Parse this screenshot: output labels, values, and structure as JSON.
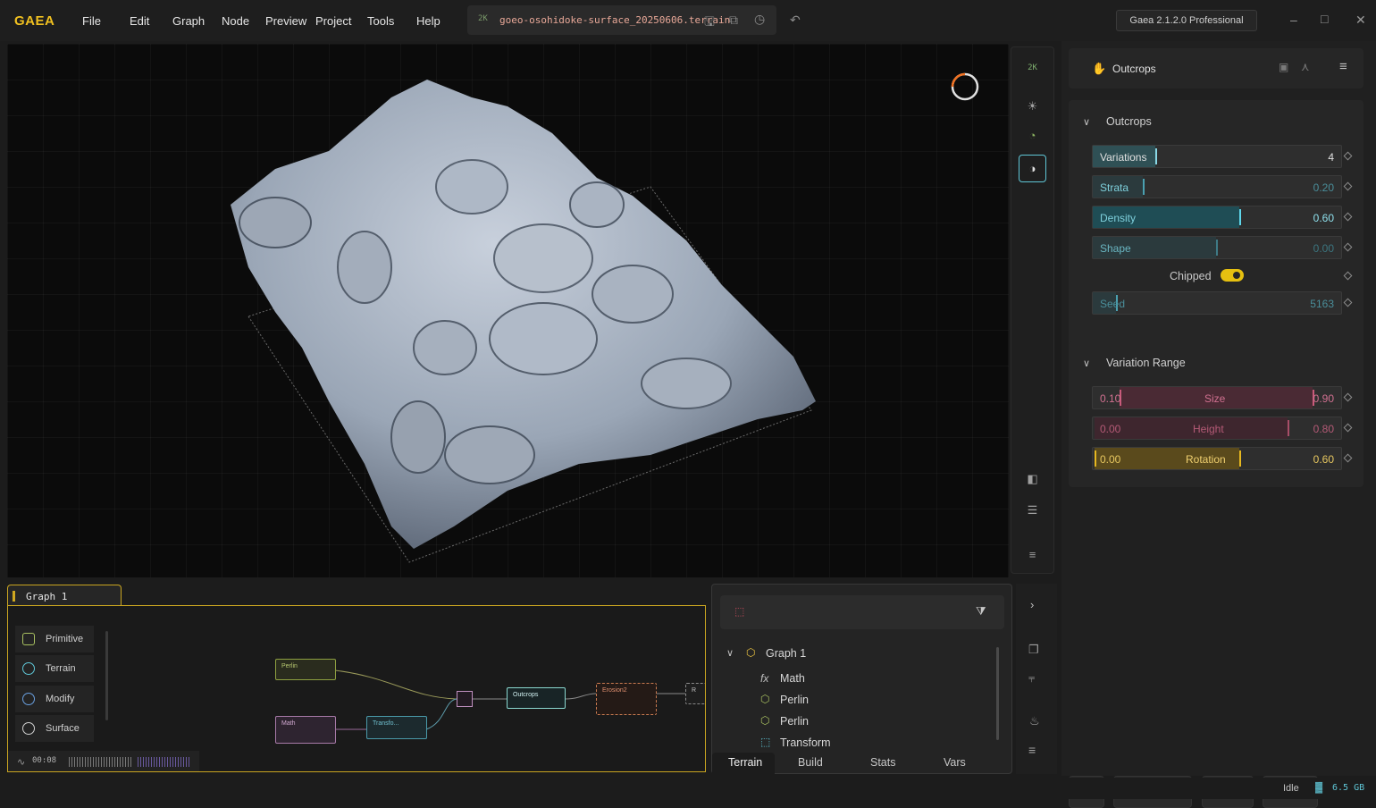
{
  "app": {
    "logo": "GAEA",
    "version": "Gaea 2.1.2.0 Professional"
  },
  "menu": [
    "File",
    "Edit",
    "Graph",
    "Node",
    "Preview",
    "Project",
    "Tools",
    "Help"
  ],
  "file": {
    "resolution_badge": "2K",
    "name": "goeo-osohidoke-surface_20250606.terrain"
  },
  "viewport_tools": {
    "resolution": "2K"
  },
  "properties": {
    "node_name": "Outcrops",
    "section1": {
      "title": "Outcrops",
      "params": [
        {
          "label": "Variations",
          "value": "4",
          "fill": 0.25
        },
        {
          "label": "Strata",
          "value": "0.20",
          "fill": 0.2
        },
        {
          "label": "Density",
          "value": "0.60",
          "fill": 0.6
        },
        {
          "label": "Shape",
          "value": "0.00",
          "fill": 0.5
        },
        {
          "label": "Seed",
          "value": "5163",
          "fill": 0.1
        }
      ],
      "toggle": {
        "label": "Chipped",
        "on": true
      }
    },
    "section2": {
      "title": "Variation Range",
      "ranges": [
        {
          "label": "Size",
          "min": "0.10",
          "max": "0.90"
        },
        {
          "label": "Height",
          "min": "0.00",
          "max": "0.80"
        },
        {
          "label": "Rotation",
          "min": "0.00",
          "max": "0.60"
        }
      ]
    }
  },
  "graph": {
    "tab": "Graph 1",
    "categories": [
      "Primitive",
      "Terrain",
      "Modify",
      "Surface"
    ],
    "nodes": [
      "Perlin",
      "Math",
      "Transfo...",
      "Outcrops",
      "Erosion2",
      "R"
    ],
    "timer": "00:08"
  },
  "hierarchy": {
    "root": "Graph 1",
    "items": [
      "Math",
      "Perlin",
      "Perlin",
      "Transform"
    ],
    "tabs": [
      "Terrain",
      "Build",
      "Stats",
      "Vars"
    ]
  },
  "status": {
    "state": "Idle",
    "memory": "6.5 GB"
  },
  "colors": {
    "accent": "#f0c020",
    "teal": "#5fc6d6",
    "pink": "#c85a7a",
    "gold": "#e6b820"
  }
}
